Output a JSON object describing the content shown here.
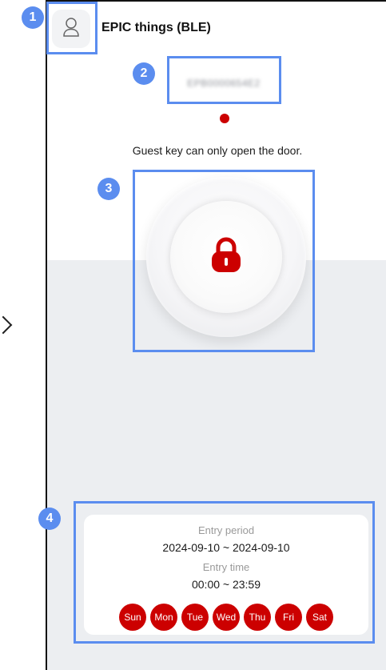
{
  "header": {
    "title": "EPIC things (BLE)",
    "avatar_icon": "user-icon"
  },
  "device": {
    "id_text": "EPB0000654E2",
    "status_color": "#cc0000"
  },
  "guest_note": "Guest key can only open the door.",
  "lock": {
    "icon": "lock-icon",
    "color": "#cc0000"
  },
  "schedule": {
    "entry_period_label": "Entry period",
    "entry_period_value": "2024-09-10 ~ 2024-09-10",
    "entry_time_label": "Entry time",
    "entry_time_value": "00:00 ~ 23:59",
    "days": [
      "Sun",
      "Mon",
      "Tue",
      "Wed",
      "Thu",
      "Fri",
      "Sat"
    ]
  },
  "annotations": {
    "badge_1": "1",
    "badge_2": "2",
    "badge_3": "3",
    "badge_4": "4",
    "color": "#5b8def"
  }
}
